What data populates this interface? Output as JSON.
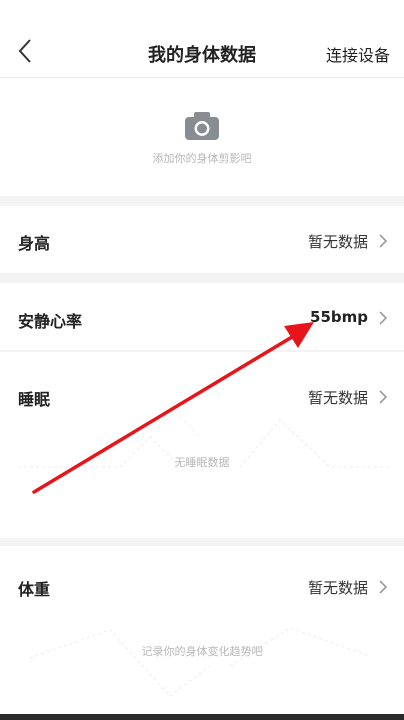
{
  "header": {
    "title": "我的身体数据",
    "connect_label": "连接设备",
    "back_icon": "chevron-left-icon"
  },
  "silhouette": {
    "hint": "添加你的身体剪影吧",
    "camera_icon": "camera-icon"
  },
  "rows": {
    "height": {
      "label": "身高",
      "value": "暂无数据"
    },
    "heart_rate": {
      "label": "安静心率",
      "value": "55bmp"
    },
    "sleep": {
      "label": "睡眠",
      "value": "暂无数据",
      "empty_hint": "无睡眠数据"
    },
    "weight": {
      "label": "体重",
      "value": "暂无数据",
      "empty_hint": "记录你的身体变化趋势吧"
    }
  },
  "colors": {
    "background": "#ffffff",
    "section_gap": "#f3f3f3",
    "hint_text": "#b8b8b8",
    "annotation_arrow": "#e8141c"
  }
}
